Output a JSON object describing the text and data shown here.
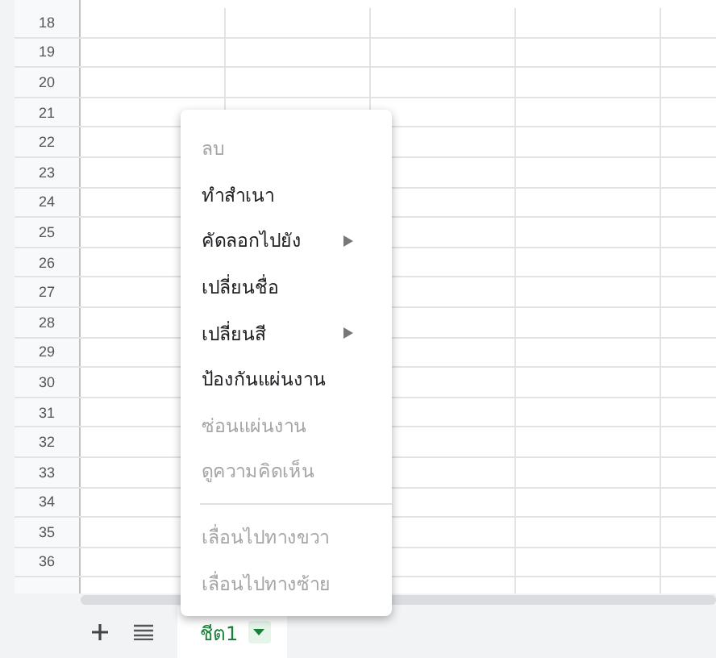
{
  "grid": {
    "row_numbers": [
      "18",
      "19",
      "20",
      "21",
      "22",
      "23",
      "24",
      "25",
      "26",
      "27",
      "28",
      "29",
      "30",
      "31",
      "32",
      "33",
      "34",
      "35",
      "36"
    ]
  },
  "context_menu": {
    "items": [
      {
        "label": "ลบ",
        "disabled": true,
        "submenu": false
      },
      {
        "label": "ทำสำเนา",
        "disabled": false,
        "submenu": false
      },
      {
        "label": "คัดลอกไปยัง",
        "disabled": false,
        "submenu": true
      },
      {
        "label": "เปลี่ยนชื่อ",
        "disabled": false,
        "submenu": false
      },
      {
        "label": "เปลี่ยนสี",
        "disabled": false,
        "submenu": true
      },
      {
        "label": "ป้องกันแผ่นงาน",
        "disabled": false,
        "submenu": false
      },
      {
        "label": "ซ่อนแผ่นงาน",
        "disabled": true,
        "submenu": false
      },
      {
        "label": "ดูความคิดเห็น",
        "disabled": true,
        "submenu": false,
        "divider_after": true
      },
      {
        "label": "เลื่อนไปทางขวา",
        "disabled": true,
        "submenu": false
      },
      {
        "label": "เลื่อนไปทางซ้าย",
        "disabled": true,
        "submenu": false
      }
    ]
  },
  "sheet_tabs": [
    {
      "label": "ชีต1",
      "selected": true
    }
  ]
}
